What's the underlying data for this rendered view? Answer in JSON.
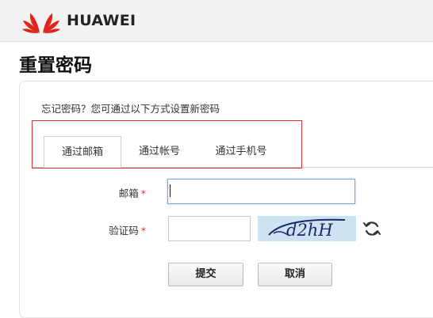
{
  "header": {
    "brand": "HUAWEI",
    "logo_color": "#e1251b"
  },
  "page_title": "重置密码",
  "hint": "忘记密码？您可通过以下方式设置新密码",
  "tabs": [
    {
      "label": "通过邮箱",
      "active": true
    },
    {
      "label": "通过帐号",
      "active": false
    },
    {
      "label": "通过手机号",
      "active": false
    }
  ],
  "form": {
    "email_label": "邮箱",
    "email_value": "",
    "captcha_label": "验证码",
    "captcha_value": "",
    "required_mark": "*",
    "captcha_text": "d2hH"
  },
  "buttons": {
    "submit": "提交",
    "cancel": "取消"
  },
  "colors": {
    "required": "#e03030",
    "highlight_box": "#e03030",
    "captcha_bg": "#cde3f2"
  },
  "icons": {
    "refresh": "refresh-icon"
  }
}
